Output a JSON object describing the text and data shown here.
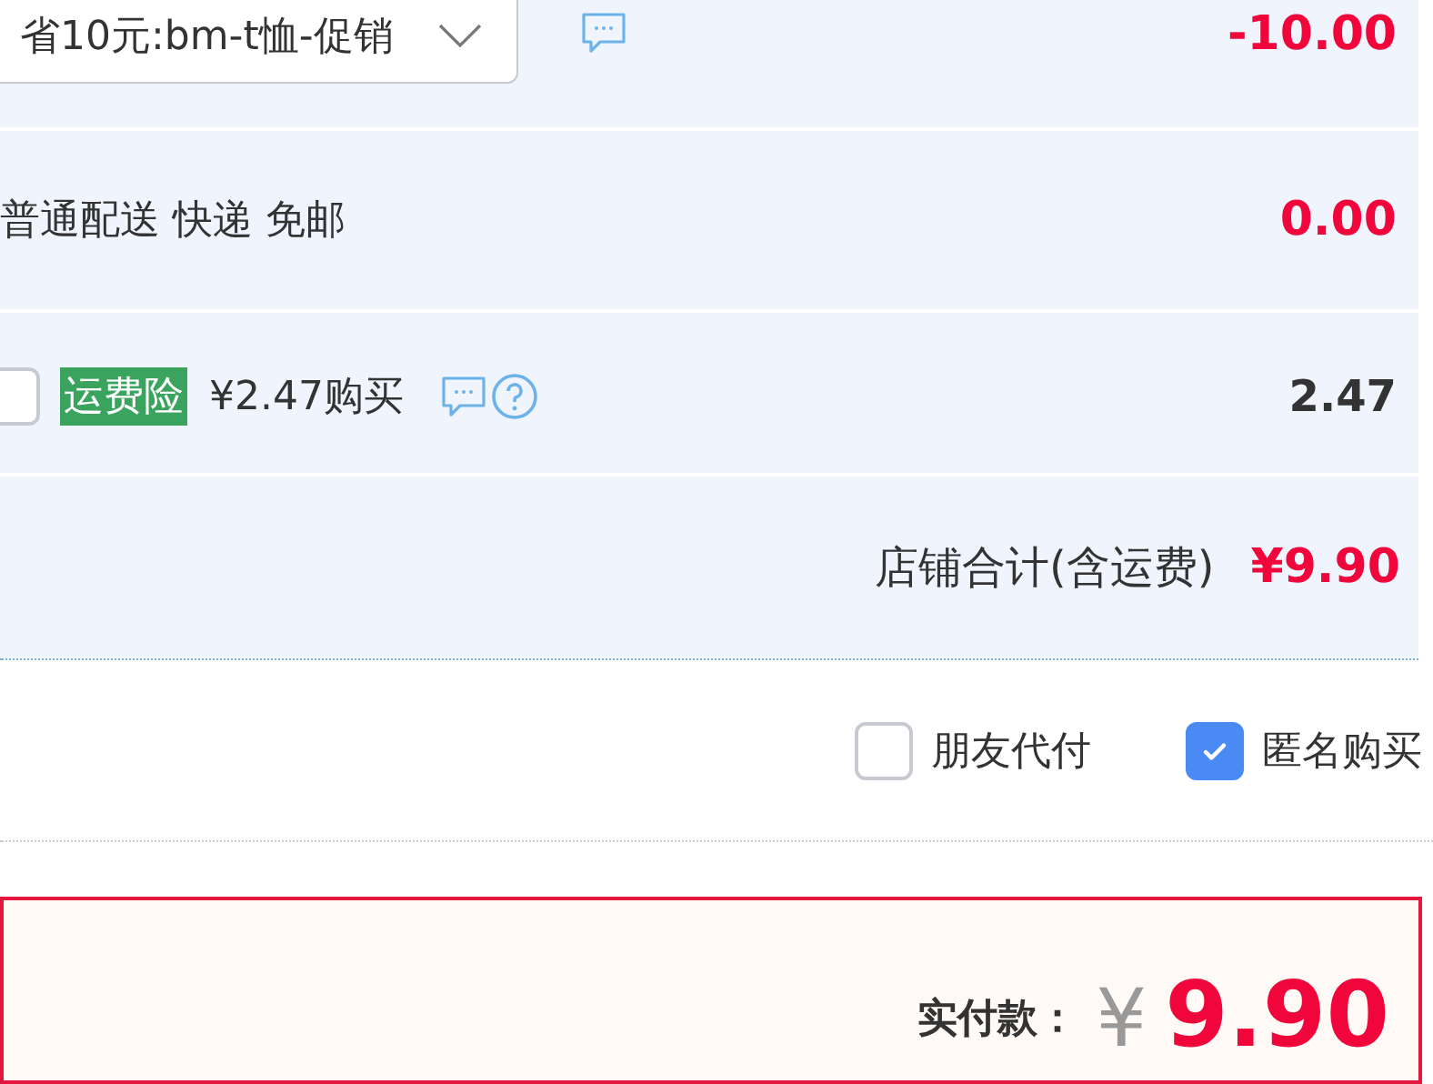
{
  "promotion": {
    "dropdown": "省10元:bm-t恤-促销",
    "amount": "-10.00"
  },
  "shipping": {
    "method": "普通配送 快递 免邮",
    "amount": "0.00"
  },
  "insurance": {
    "checked": false,
    "tag": "运费险",
    "price": "¥2.47购买",
    "amount": "2.47"
  },
  "shop_total": {
    "label": "店铺合计(含运费)",
    "amount": "¥9.90"
  },
  "options": [
    {
      "label": "朋友代付",
      "checked": false
    },
    {
      "label": "匿名购买",
      "checked": true
    }
  ],
  "payment": {
    "label": "实付款：",
    "currency": "¥",
    "amount": "9.90"
  }
}
